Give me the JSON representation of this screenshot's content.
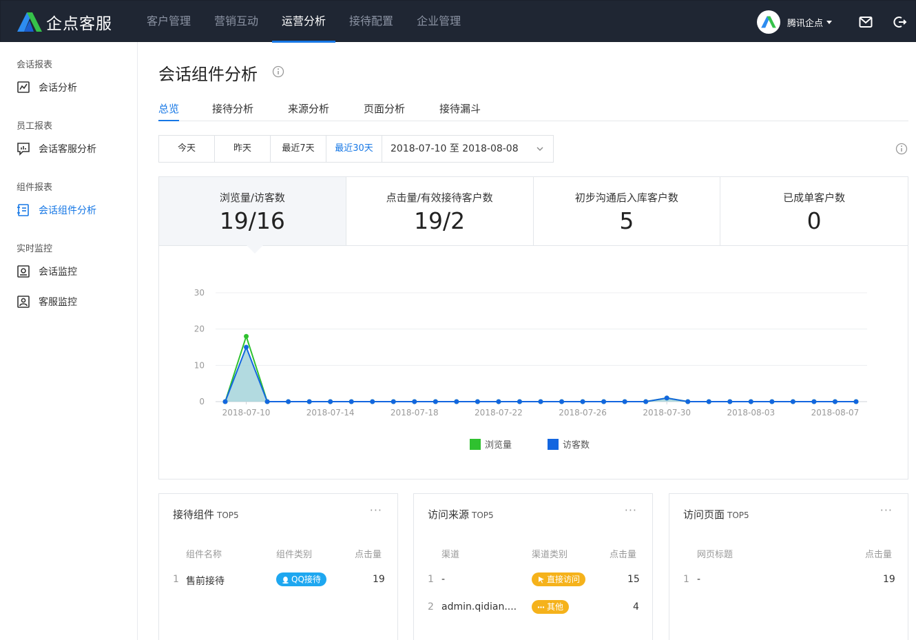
{
  "app": {
    "name": "企点客服",
    "nav": [
      "客户管理",
      "营销互动",
      "运营分析",
      "接待配置",
      "企业管理"
    ],
    "active_nav": "运营分析",
    "user_name": "腾讯企点",
    "brand_color": "#1677e5"
  },
  "sidebar": {
    "groups": [
      {
        "title": "会话报表",
        "items": [
          {
            "label": "会话分析",
            "icon": "trend-chart-icon"
          }
        ]
      },
      {
        "title": "员工报表",
        "items": [
          {
            "label": "会话客服分析",
            "icon": "chat-chart-icon"
          }
        ]
      },
      {
        "title": "组件报表",
        "items": [
          {
            "label": "会话组件分析",
            "icon": "widget-icon",
            "active": true
          }
        ]
      },
      {
        "title": "实时监控",
        "items": [
          {
            "label": "会话监控",
            "icon": "monitor-icon"
          },
          {
            "label": "客服监控",
            "icon": "agent-monitor-icon"
          }
        ]
      }
    ]
  },
  "main": {
    "title": "会话组件分析",
    "tabs": [
      "总览",
      "接待分析",
      "来源分析",
      "页面分析",
      "接待漏斗"
    ],
    "active_tab": "总览",
    "date_buttons": [
      "今天",
      "昨天",
      "最近7天",
      "最近30天"
    ],
    "active_date": "最近30天",
    "date_range": "2018-07-10 至 2018-08-08"
  },
  "kpis": [
    {
      "label": "浏览量/访客数",
      "value": "19/16"
    },
    {
      "label": "点击量/有效接待客户数",
      "value": "19/2"
    },
    {
      "label": "初步沟通后入库客户数",
      "value": "5"
    },
    {
      "label": "已成单客户数",
      "value": "0"
    }
  ],
  "chart_data": {
    "type": "line",
    "x_tick_labels": [
      "2018-07-10",
      "2018-07-14",
      "2018-07-18",
      "2018-07-22",
      "2018-07-26",
      "2018-07-30",
      "2018-08-03",
      "2018-08-07"
    ],
    "y_ticks": [
      0,
      10,
      20,
      30
    ],
    "ylim": [
      0,
      30
    ],
    "x": [
      "2018-07-09",
      "2018-07-10",
      "2018-07-11",
      "2018-07-12",
      "2018-07-13",
      "2018-07-14",
      "2018-07-15",
      "2018-07-16",
      "2018-07-17",
      "2018-07-18",
      "2018-07-19",
      "2018-07-20",
      "2018-07-21",
      "2018-07-22",
      "2018-07-23",
      "2018-07-24",
      "2018-07-25",
      "2018-07-26",
      "2018-07-27",
      "2018-07-28",
      "2018-07-29",
      "2018-07-30",
      "2018-07-31",
      "2018-08-01",
      "2018-08-02",
      "2018-08-03",
      "2018-08-04",
      "2018-08-05",
      "2018-08-06",
      "2018-08-07",
      "2018-08-08"
    ],
    "series": [
      {
        "name": "浏览量",
        "color": "#2fc12f",
        "values": [
          0,
          18,
          0,
          0,
          0,
          0,
          0,
          0,
          0,
          0,
          0,
          0,
          0,
          0,
          0,
          0,
          0,
          0,
          0,
          0,
          0,
          1,
          0,
          0,
          0,
          0,
          0,
          0,
          0,
          0,
          0
        ]
      },
      {
        "name": "访客数",
        "color": "#1366e0",
        "values": [
          0,
          15,
          0,
          0,
          0,
          0,
          0,
          0,
          0,
          0,
          0,
          0,
          0,
          0,
          0,
          0,
          0,
          0,
          0,
          0,
          0,
          1,
          0,
          0,
          0,
          0,
          0,
          0,
          0,
          0,
          0
        ]
      }
    ],
    "legend_position": "bottom-center",
    "grid": true
  },
  "cards": {
    "widgets": {
      "title": "接待组件",
      "suffix": "TOP5",
      "headers": [
        "组件名称",
        "组件类别",
        "点击量"
      ],
      "rows": [
        {
          "idx": "1",
          "name": "售前接待",
          "badge": "QQ接待",
          "badge_color": "#1ea7f0",
          "badge_icon": "qq-icon",
          "count": "19"
        }
      ]
    },
    "sources": {
      "title": "访问来源",
      "suffix": "TOP5",
      "headers": [
        "渠道",
        "渠道类别",
        "点击量"
      ],
      "rows": [
        {
          "idx": "1",
          "name": "-",
          "badge": "直接访问",
          "badge_color": "#f5b21b",
          "badge_icon": "cursor-icon",
          "count": "15"
        },
        {
          "idx": "2",
          "name": "admin.qidian....",
          "badge": "其他",
          "badge_color": "#f5b21b",
          "badge_icon": "dots-icon",
          "count": "4"
        }
      ]
    },
    "pages": {
      "title": "访问页面",
      "suffix": "TOP5",
      "headers": [
        "网页标题",
        "点击量"
      ],
      "rows": [
        {
          "idx": "1",
          "name": "-",
          "count": "19"
        }
      ]
    }
  }
}
